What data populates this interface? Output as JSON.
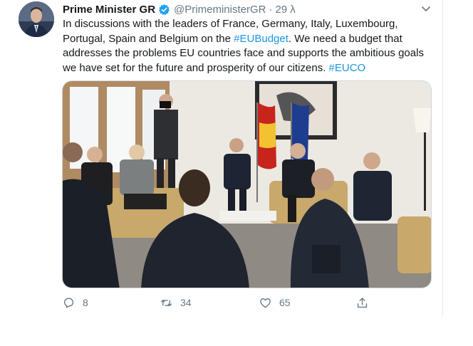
{
  "tweet": {
    "author_name": "Prime Minister GR",
    "handle": "@PrimeministerGR",
    "separator": "·",
    "time": "29 λ",
    "text_parts": [
      "In discussions with the leaders of France, Germany, Italy, Luxembourg, Portugal, Spain and Belgium on the ",
      "#EUBudget",
      ". We need a budget that addresses the problems EU countries face and supports the ambitious goals we have set for the future and prosperity of our citizens. ",
      "#EUCO"
    ],
    "accent_color": "#1b95e0",
    "verified_icon": "verified-badge-icon",
    "media": {
      "description_icon": "meeting-photo"
    }
  },
  "actions": {
    "reply_count": "8",
    "retweet_count": "34",
    "like_count": "65"
  },
  "icons": [
    "reply-icon",
    "retweet-icon",
    "like-icon",
    "share-icon",
    "chevron-down-icon"
  ]
}
